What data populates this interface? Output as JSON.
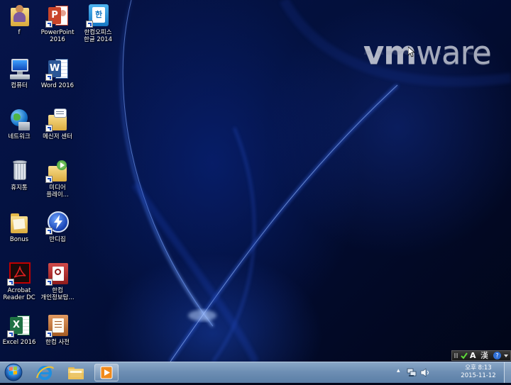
{
  "desktop": {
    "wordmark_a": "vm",
    "wordmark_b": "ware",
    "icons": [
      {
        "label": "f"
      },
      {
        "label": "PowerPoint\n2016",
        "tile": "P"
      },
      {
        "label": "한컴오피스\n한글 2014",
        "tile": "한"
      },
      {
        "label": "컴퓨터"
      },
      {
        "label": "Word 2016",
        "tile": "W"
      },
      {
        "label": "네트워크"
      },
      {
        "label": "메신저 센터"
      },
      {
        "label": "휴지통"
      },
      {
        "label": "미디어\n플레이..."
      },
      {
        "label": "Bonus"
      },
      {
        "label": "반디집"
      },
      {
        "label": "Acrobat\nReader DC"
      },
      {
        "label": "한컴\n개인정보탐..."
      },
      {
        "label": "Excel 2016",
        "tile": "X"
      },
      {
        "label": "한컴 사전"
      }
    ]
  },
  "language_bar": {
    "mode": "A",
    "hanja": "漢",
    "help": "?"
  },
  "taskbar": {
    "clock_time": "오후 8:13",
    "clock_date": "2015-11-12",
    "tray_arrow": "▴"
  },
  "colors": {
    "powerpoint": "#c9452a",
    "word": "#2b5797",
    "excel": "#1f7244",
    "hancom_blue": "#1b8fd6",
    "acrobat": "#c00000"
  }
}
